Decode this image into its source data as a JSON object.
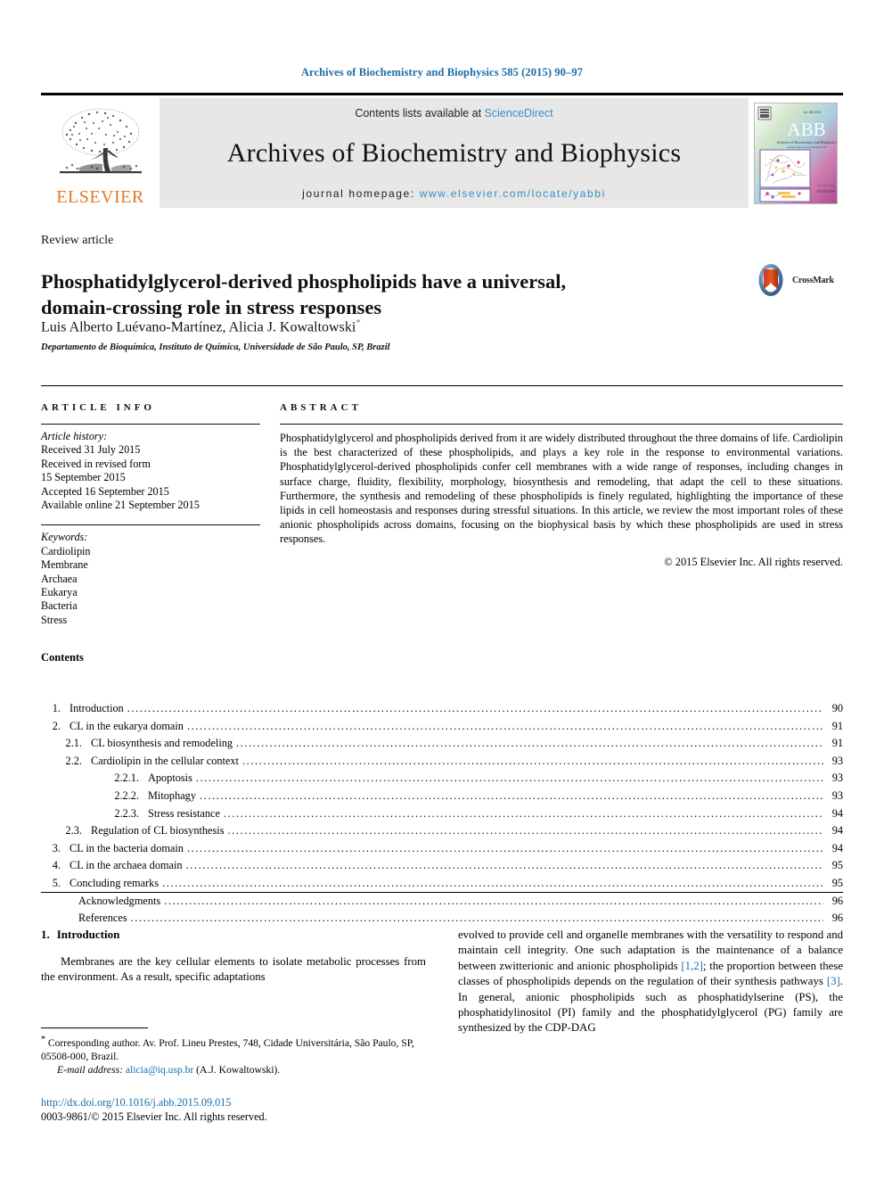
{
  "running_head": "Archives of Biochemistry and Biophysics 585 (2015) 90–97",
  "masthead": {
    "contents_prefix": "Contents lists available at ",
    "sciencedirect": "ScienceDirect",
    "journal_title": "Archives of Biochemistry and Biophysics",
    "homepage_prefix": "journal homepage: ",
    "homepage_url": "www.elsevier.com/locate/yabbi",
    "publisher_wordmark": "ELSEVIER",
    "cover_journal_initials": "ABB",
    "cover_journal_subtitle": "Archives of Biochemistry and Biophysics",
    "cover_publisher": "ELSEVIER",
    "link_color": "#3b8ec4",
    "band_color": "#e7e7e7",
    "elsevier_orange": "#E87722"
  },
  "article": {
    "kicker": "Review article",
    "title_line1": "Phosphatidylglycerol-derived phospholipids have a universal,",
    "title_line2": "domain-crossing role in stress responses",
    "authors": "Luis Alberto Luévano-Martínez, Alicia J. Kowaltowski",
    "corresponding_marker": "*",
    "affiliation": "Departamento de Bioquímica, Instituto de Química, Universidade de São Paulo, SP, Brazil",
    "crossmark_label": "CrossMark"
  },
  "article_info": {
    "heading": "ARTICLE INFO",
    "history_heading": "Article history:",
    "history": [
      "Received 31 July 2015",
      "Received in revised form",
      "15 September 2015",
      "Accepted 16 September 2015",
      "Available online 21 September 2015"
    ],
    "keywords_heading": "Keywords:",
    "keywords": [
      "Cardiolipin",
      "Membrane",
      "Archaea",
      "Eukarya",
      "Bacteria",
      "Stress"
    ]
  },
  "abstract": {
    "heading": "ABSTRACT",
    "text": "Phosphatidylglycerol and phospholipids derived from it are widely distributed throughout the three domains of life. Cardiolipin is the best characterized of these phospholipids, and plays a key role in the response to environmental variations. Phosphatidylglycerol-derived phospholipids confer cell membranes with a wide range of responses, including changes in surface charge, fluidity, flexibility, morphology, biosynthesis and remodeling, that adapt the cell to these situations. Furthermore, the synthesis and remodeling of these phospholipids is finely regulated, highlighting the importance of these lipids in cell homeostasis and responses during stressful situations. In this article, we review the most important roles of these anionic phospholipids across domains, focusing on the biophysical basis by which these phospholipids are used in stress responses.",
    "copyright": "© 2015 Elsevier Inc. All rights reserved."
  },
  "contents": {
    "heading": "Contents",
    "entries": [
      {
        "num": "1.",
        "label": "Introduction",
        "page": "90",
        "level": 1
      },
      {
        "num": "2.",
        "label": "CL in the eukarya domain",
        "page": "91",
        "level": 1
      },
      {
        "num": "2.1.",
        "label": "CL biosynthesis and remodeling",
        "page": "91",
        "level": 2
      },
      {
        "num": "2.2.",
        "label": "Cardiolipin in the cellular context",
        "page": "93",
        "level": 2
      },
      {
        "num": "2.2.1.",
        "label": "Apoptosis",
        "page": "93",
        "level": 3
      },
      {
        "num": "2.2.2.",
        "label": "Mitophagy",
        "page": "93",
        "level": 3
      },
      {
        "num": "2.2.3.",
        "label": "Stress resistance",
        "page": "94",
        "level": 3
      },
      {
        "num": "2.3.",
        "label": "Regulation of CL biosynthesis",
        "page": "94",
        "level": 2
      },
      {
        "num": "3.",
        "label": "CL in the bacteria domain",
        "page": "94",
        "level": 1
      },
      {
        "num": "4.",
        "label": "CL in the archaea domain",
        "page": "95",
        "level": 1
      },
      {
        "num": "5.",
        "label": "Concluding remarks",
        "page": "95",
        "level": 1
      },
      {
        "num": "",
        "label": "Acknowledgments",
        "page": "96",
        "level": 0
      },
      {
        "num": "",
        "label": "References",
        "page": "96",
        "level": 0
      }
    ]
  },
  "body": {
    "section_number": "1.",
    "section_title": "Introduction",
    "left_paragraph": "Membranes are the key cellular elements to isolate metabolic processes from the environment. As a result, specific adaptations",
    "right_paragraph_a": "evolved to provide cell and organelle membranes with the versatility to respond and maintain cell integrity. One such adaptation is the maintenance of a balance between zwitterionic and anionic phospholipids ",
    "right_ref_1": "[1,2]",
    "right_paragraph_b": "; the proportion between these classes of phospholipids depends on the regulation of their synthesis pathways ",
    "right_ref_2": "[3]",
    "right_paragraph_c": ". In general, anionic phospholipids such as phosphatidylserine (PS), the phosphatidylinositol (PI) family and the phosphatidylglycerol (PG) family are synthesized by the CDP-DAG"
  },
  "footnotes": {
    "star": "*",
    "corresponding": " Corresponding author. Av. Prof. Lineu Prestes, 748, Cidade Universitária, São Paulo, SP, 05508-000, Brazil.",
    "email_label": "E-mail address:",
    "email": "alicia@iq.usp.br",
    "email_owner": "(A.J. Kowaltowski).",
    "doi": "http://dx.doi.org/10.1016/j.abb.2015.09.015",
    "issn_line": "0003-9861/© 2015 Elsevier Inc. All rights reserved."
  }
}
